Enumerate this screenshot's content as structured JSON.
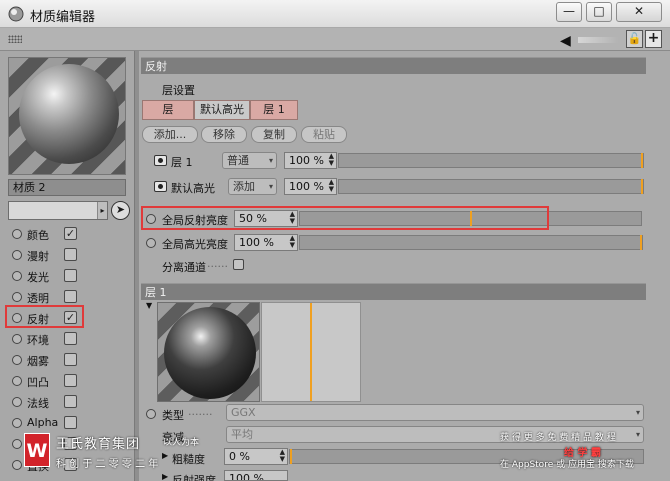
{
  "window": {
    "title": "材质编辑器",
    "min_glyph": "—",
    "max_glyph": "□",
    "close_glyph": "✕"
  },
  "material": {
    "name": "材质 2"
  },
  "channels": [
    {
      "label": "颜色",
      "checked": true
    },
    {
      "label": "漫射",
      "checked": false
    },
    {
      "label": "发光",
      "checked": false
    },
    {
      "label": "透明",
      "checked": false
    },
    {
      "label": "反射",
      "checked": true
    },
    {
      "label": "环境",
      "checked": false
    },
    {
      "label": "烟雾",
      "checked": false
    },
    {
      "label": "凹凸",
      "checked": false
    },
    {
      "label": "法线",
      "checked": false
    },
    {
      "label": "Alpha",
      "checked": false
    },
    {
      "label": "辉光",
      "checked": false
    },
    {
      "label": "置换",
      "checked": false
    }
  ],
  "reflectance": {
    "section_title": "反射",
    "layer_settings_label": "层设置",
    "tabs": [
      "层",
      "默认高光",
      "层 1"
    ],
    "buttons": {
      "add": "添加...",
      "remove": "移除",
      "copy": "复制",
      "paste": "粘贴"
    },
    "layers": [
      {
        "name": "层 1",
        "mode": "普通",
        "value": "100 %",
        "fraction": 1.0
      },
      {
        "name": "默认高光",
        "mode": "添加",
        "value": "100 %",
        "fraction": 1.0
      }
    ],
    "global_reflection_label": "全局反射亮度",
    "global_reflection_value": "50 %",
    "global_reflection_fraction": 0.5,
    "global_specular_label": "全局高光亮度",
    "global_specular_value": "100 %",
    "global_specular_fraction": 1.0,
    "separate_pass_label": "分离通道",
    "separate_pass_dots": "......"
  },
  "layer1": {
    "section_title": "层 1",
    "type_label": "类型",
    "type_dots": ".......",
    "type_value": "GGX",
    "attenuation_label": "衰减",
    "attenuation_value": "平均",
    "roughness_label": "粗糙度",
    "roughness_value": "0 %",
    "roughness_fraction": 0.0,
    "reflect_strength_label": "反射强度",
    "reflect_strength_value": "100 %"
  },
  "watermark": {
    "logo_letter": "W",
    "org_name": "王氏教育集团",
    "slogan": "以人为本",
    "motto": "科 创 于 二 零 零 二 年",
    "promo_line1": "获 得 更 多 免 费 精 品 教 程",
    "promo_line2": "给 学 霸",
    "promo_line3": "在 AppStore 或 应用宝 搜索下载"
  },
  "colors": {
    "highlight_box": "#e03a3a",
    "slider_marker": "#f0a020",
    "layer_tab": "#d9a9a4"
  }
}
